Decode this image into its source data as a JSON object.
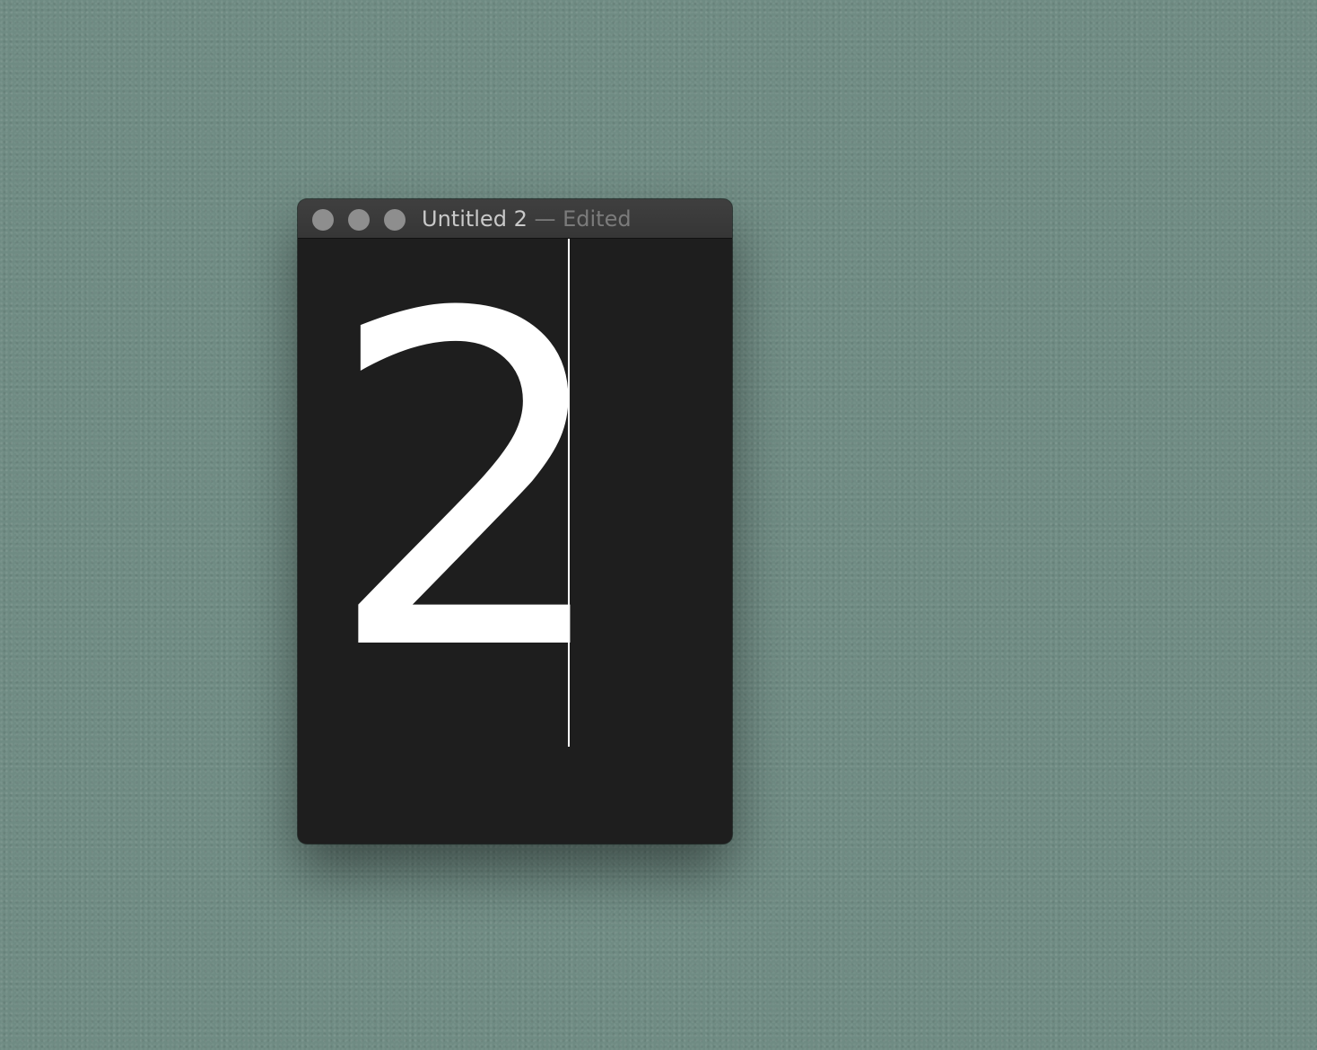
{
  "window": {
    "title": "Untitled 2",
    "title_separator": " — ",
    "edited_label": "Edited"
  },
  "document": {
    "text": "2"
  }
}
